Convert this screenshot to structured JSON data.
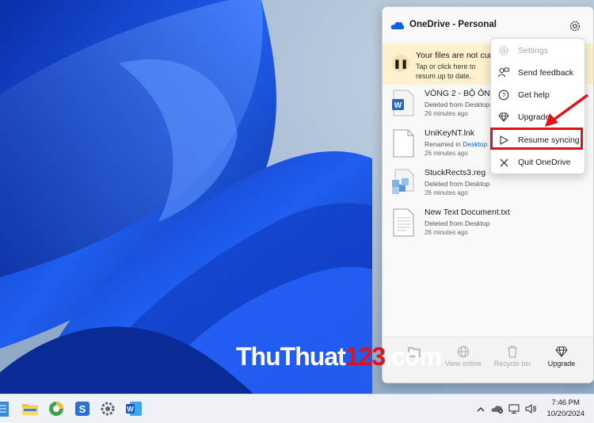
{
  "panel": {
    "title": "OneDrive - Personal",
    "banner": {
      "title": "Your files are not cur",
      "description": "Tap or click here to resum up to date."
    },
    "files": [
      {
        "name": "VÒNG 2 - BỘ ÔN",
        "status": "Deleted from Desktop",
        "link": "",
        "time": "26 minutes ago",
        "icon": "word-doc-icon"
      },
      {
        "name": "UniKeyNT.lnk",
        "status": "Renamed in ",
        "link": "Desktop",
        "time": "26 minutes ago",
        "icon": "blank-file-icon"
      },
      {
        "name": "StuckRects3.reg",
        "status": "Deleted from Desktop",
        "link": "",
        "time": "26 minutes ago",
        "icon": "registry-file-icon"
      },
      {
        "name": "New Text Document.txt",
        "status": "Deleted from Desktop",
        "link": "",
        "time": "26 minutes ago",
        "icon": "text-file-icon"
      }
    ],
    "footer": [
      {
        "label": "",
        "icon": "folder-icon"
      },
      {
        "label": "View online",
        "icon": "globe-icon"
      },
      {
        "label": "Recycle bin",
        "icon": "trash-icon"
      },
      {
        "label": "Upgrade",
        "icon": "diamond-icon"
      }
    ]
  },
  "menu": {
    "items": [
      {
        "label": "Settings",
        "icon": "gear-icon",
        "disabled": true
      },
      {
        "label": "Send feedback",
        "icon": "feedback-icon",
        "disabled": false
      },
      {
        "label": "Get help",
        "icon": "help-icon",
        "disabled": false
      },
      {
        "label": "Upgrade",
        "icon": "diamond-icon",
        "disabled": false
      },
      {
        "label": "Resume syncing",
        "icon": "play-icon",
        "disabled": false
      },
      {
        "label": "Quit OneDrive",
        "icon": "close-icon",
        "disabled": false
      }
    ]
  },
  "watermark": {
    "text_a": "ThuThuat",
    "text_b": "123",
    "text_c": ".com"
  },
  "taskbar": {
    "icons": [
      "notepad-icon",
      "file-explorer-icon",
      "browser-icon",
      "sublime-icon",
      "settings-icon",
      "word-icon"
    ],
    "tray_icons": [
      "chevron-up-icon",
      "onedrive-paused-icon",
      "network-icon",
      "volume-icon"
    ],
    "time": "7:46 PM",
    "date": "10/20/2024"
  },
  "colors": {
    "accent": "#0067c0",
    "highlight": "#e0131d",
    "banner": "#fdf0cc"
  }
}
